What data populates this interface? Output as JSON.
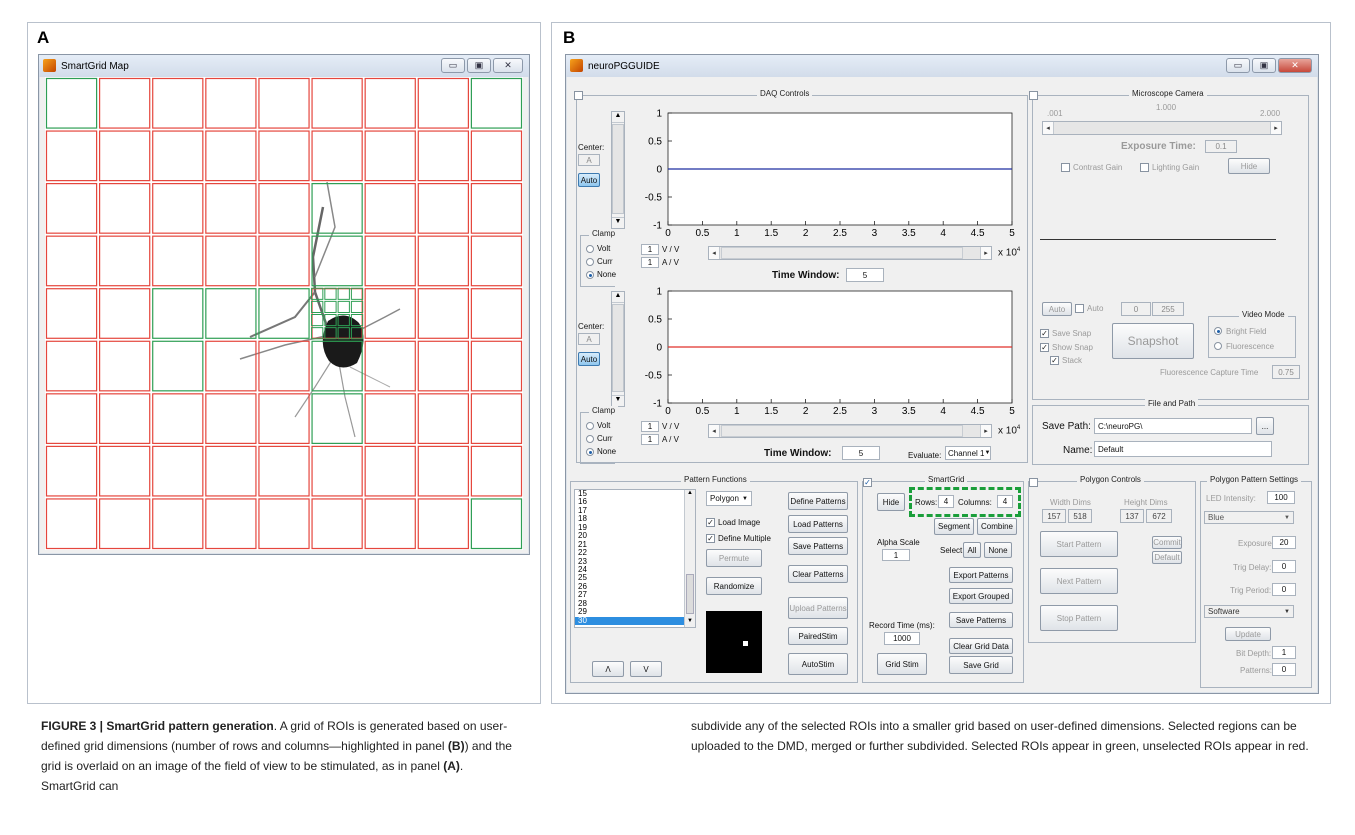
{
  "panel_a": {
    "label": "A",
    "title": "SmartGrid Map",
    "grid_rows": 9,
    "grid_cols": 9,
    "green_cells": [
      [
        0,
        0
      ],
      [
        0,
        8
      ],
      [
        2,
        5
      ],
      [
        3,
        5
      ],
      [
        4,
        2
      ],
      [
        4,
        3
      ],
      [
        4,
        4
      ],
      [
        5,
        2
      ],
      [
        5,
        5
      ],
      [
        6,
        5
      ],
      [
        8,
        8
      ]
    ],
    "colors": {
      "selected": "#2e9e54",
      "unselected": "#e5463d"
    }
  },
  "panel_b": {
    "label": "B",
    "title": "neuroPGGUIDE",
    "daq": {
      "title": "DAQ Controls",
      "center_label": "Center:",
      "center_value": "A",
      "auto_label": "Auto",
      "clamp_title": "Clamp",
      "clamp_volt": "Volt",
      "clamp_curr": "Curr",
      "clamp_none": "None",
      "volt_val": "1",
      "volt_unit": "V / V",
      "curr_val": "1",
      "curr_unit": "A / V",
      "time_window_label": "Time Window:",
      "time_window_value": "5",
      "x_exponent_base": "x 10",
      "x_exponent_pow": "4",
      "evaluate_label": "Evaluate:",
      "evaluate_value": "Channel 1"
    },
    "camera": {
      "title": "Microscope Camera",
      "tick_min": ".001",
      "tick_mid": "1.000",
      "tick_max": "2.000",
      "exposure_label": "Exposure Time:",
      "exposure_value": "0.1",
      "contrast_gain": "Contrast Gain",
      "lighting_gain": "Lighting Gain",
      "hide": "Hide",
      "auto_btn": "Auto",
      "auto_chk": "Auto",
      "range_min": "0",
      "range_max": "255",
      "save_snap": "Save Snap",
      "show_snap": "Show Snap",
      "stack": "Stack",
      "snapshot": "Snapshot",
      "video_mode_title": "Video Mode",
      "bright_field": "Bright Field",
      "fluorescence": "Fluorescence",
      "capture_time_label": "Fluorescence Capture Time",
      "capture_time_value": "0.75"
    },
    "file": {
      "title": "File and Path",
      "save_path_label": "Save Path:",
      "save_path_value": "C:\\neuroPG\\",
      "browse": "...",
      "name_label": "Name:",
      "name_value": "Default"
    },
    "pattern_functions": {
      "title": "Pattern Functions",
      "list_items": [
        "15",
        "16",
        "17",
        "18",
        "19",
        "20",
        "21",
        "22",
        "23",
        "24",
        "25",
        "26",
        "27",
        "28",
        "29",
        "30"
      ],
      "selected_item": "30",
      "shape_value": "Polygon",
      "load_image": "Load Image",
      "define_multiple": "Define Multiple",
      "permute": "Permute",
      "randomize": "Randomize",
      "define_patterns": "Define Patterns",
      "load_patterns": "Load Patterns",
      "save_patterns": "Save Patterns",
      "clear_patterns": "Clear Patterns",
      "upload_patterns": "Upload Patterns",
      "paired_stim": "PairedStim",
      "auto_stim": "AutoStim",
      "up_btn": "Λ",
      "down_btn": "V"
    },
    "smartgrid": {
      "title": "SmartGrid",
      "hide": "Hide",
      "rows_label": "Rows:",
      "rows_value": "4",
      "columns_label": "Columns:",
      "columns_value": "4",
      "segment": "Segment",
      "combine": "Combine",
      "alpha_label": "Alpha Scale",
      "alpha_value": "1",
      "select_label": "Select:",
      "select_all": "All",
      "select_none": "None",
      "export_patterns": "Export Patterns",
      "export_grouped": "Export Grouped",
      "save_patterns": "Save Patterns",
      "record_time_label": "Record Time (ms):",
      "record_time_value": "1000",
      "clear_grid_data": "Clear Grid Data",
      "grid_stim": "Grid Stim",
      "save_grid": "Save Grid"
    },
    "polygon_controls": {
      "title": "Polygon Controls",
      "width_dims": "Width Dims",
      "height_dims": "Height Dims",
      "w1": "157",
      "w2": "518",
      "h1": "137",
      "h2": "672",
      "start_pattern": "Start Pattern",
      "commit": "Commit",
      "default": "Default",
      "next_pattern": "Next Pattern",
      "stop_pattern": "Stop Pattern"
    },
    "polygon_settings": {
      "title": "Polygon Pattern Settings",
      "led_label": "LED Intensity:",
      "led_value": "100",
      "color_value": "Blue",
      "exposure_label": "Exposure:",
      "exposure_value": "20",
      "trig_delay_label": "Trig Delay:",
      "trig_delay_value": "0",
      "trig_period_label": "Trig Period:",
      "trig_period_value": "0",
      "trigger_value": "Software",
      "update": "Update",
      "bit_depth_label": "Bit Depth:",
      "bit_depth_value": "1",
      "patterns_label": "Patterns:",
      "patterns_value": "0"
    }
  },
  "chart_data": [
    {
      "type": "line",
      "x": [
        0,
        50000
      ],
      "y": [
        0,
        0
      ],
      "xlim": [
        0,
        50000
      ],
      "ylim": [
        -1,
        1
      ],
      "xticks": [
        "0",
        "0.5",
        "1",
        "1.5",
        "2",
        "2.5",
        "3",
        "3.5",
        "4",
        "4.5",
        "5"
      ],
      "yticks": [
        "1",
        "0.5",
        "0",
        "-0.5",
        "-1"
      ],
      "color": "#1f2fa0"
    },
    {
      "type": "line",
      "x": [
        0,
        50000
      ],
      "y": [
        0,
        0
      ],
      "xlim": [
        0,
        50000
      ],
      "ylim": [
        -1,
        1
      ],
      "xticks": [
        "0",
        "0.5",
        "1",
        "1.5",
        "2",
        "2.5",
        "3",
        "3.5",
        "4",
        "4.5",
        "5"
      ],
      "yticks": [
        "1",
        "0.5",
        "0",
        "-0.5",
        "-1"
      ],
      "color": "#e0302a"
    }
  ],
  "caption": {
    "fig_label": "FIGURE 3 | SmartGrid pattern generation",
    "col1_rest": ". A grid of ROIs is generated based on user-defined grid dimensions (number of rows and columns—highlighted in panel ",
    "ref_b": "(B)",
    "col1_mid": ") and the grid is overlaid on an image of the field of view to be stimulated, as in panel ",
    "ref_a": "(A)",
    "col1_end": ". SmartGrid can",
    "col2": "subdivide any of the selected ROIs into a smaller grid based on user-defined dimensions. Selected regions can be uploaded to the DMD, merged or further subdivided. Selected ROIs appear in green, unselected ROIs appear in red."
  }
}
